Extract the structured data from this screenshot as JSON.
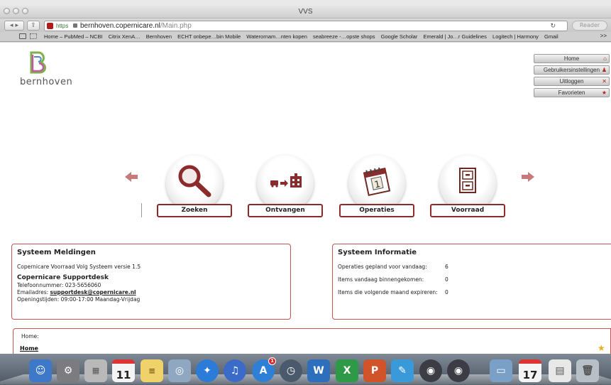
{
  "window": {
    "title": "VVS"
  },
  "toolbar": {
    "url_scheme": "https",
    "url_host": "bernhoven.copernicare.nl",
    "url_path": "/Main.php",
    "reader_label": "Reader"
  },
  "bookmarks": {
    "items": [
      "Home – PubMed – NCBI",
      "Citrix XenA…",
      "Bernhoven",
      "ECHT onbepe…bin Mobile",
      "Waterornam…nten kopen",
      "seabreeze -…opste shops",
      "Google Scholar",
      "Emerald | Jo…r Guidelines",
      "Logitech | Harmony",
      "Gmail"
    ],
    "more_label": ">>"
  },
  "logo": {
    "text": "bernhoven"
  },
  "side_menu": [
    {
      "label": "Home",
      "icon": "home-icon"
    },
    {
      "label": "Gebruikersinstellingen",
      "icon": "user-icon"
    },
    {
      "label": "Uitloggen",
      "icon": "close-icon"
    },
    {
      "label": "Favorieten",
      "icon": "star-icon"
    }
  ],
  "tiles": [
    {
      "label": "Zoeken",
      "icon": "magnifier-icon"
    },
    {
      "label": "Ontvangen",
      "icon": "truck-to-hospital-icon"
    },
    {
      "label": "Operaties",
      "icon": "calendar-icon"
    },
    {
      "label": "Voorraad",
      "icon": "filing-cabinet-icon"
    }
  ],
  "meldingen": {
    "title": "Systeem Meldingen",
    "version_line": "Copernicare Voorraad Volg Systeem versie 1.5",
    "support_title": "Copernicare Supportdesk",
    "phone_line": "Telefoonnummer: 023-5656060",
    "email_label": "Emailadres: ",
    "email": "supportdesk@copernicare.nl",
    "hours_line": "Openingstijden: 09:00-17:00 Maandag-Vrijdag"
  },
  "informatie": {
    "title": "Systeem Informatie",
    "rows": [
      {
        "label": "Operaties gepland voor vandaag:",
        "value": "6"
      },
      {
        "label": "Items vandaag binnengekomen:",
        "value": "0"
      },
      {
        "label": "Items die volgende maand expireren:",
        "value": "0"
      }
    ]
  },
  "breadcrumb": {
    "label": "Home:",
    "link": "Home"
  },
  "dock": {
    "calendar_day_1": "11",
    "calendar_day_2": "17",
    "appstore_badge": "1"
  },
  "colors": {
    "accent": "#8b2b2b",
    "panel_border": "#c05656",
    "arrow": "#c77a7a"
  }
}
